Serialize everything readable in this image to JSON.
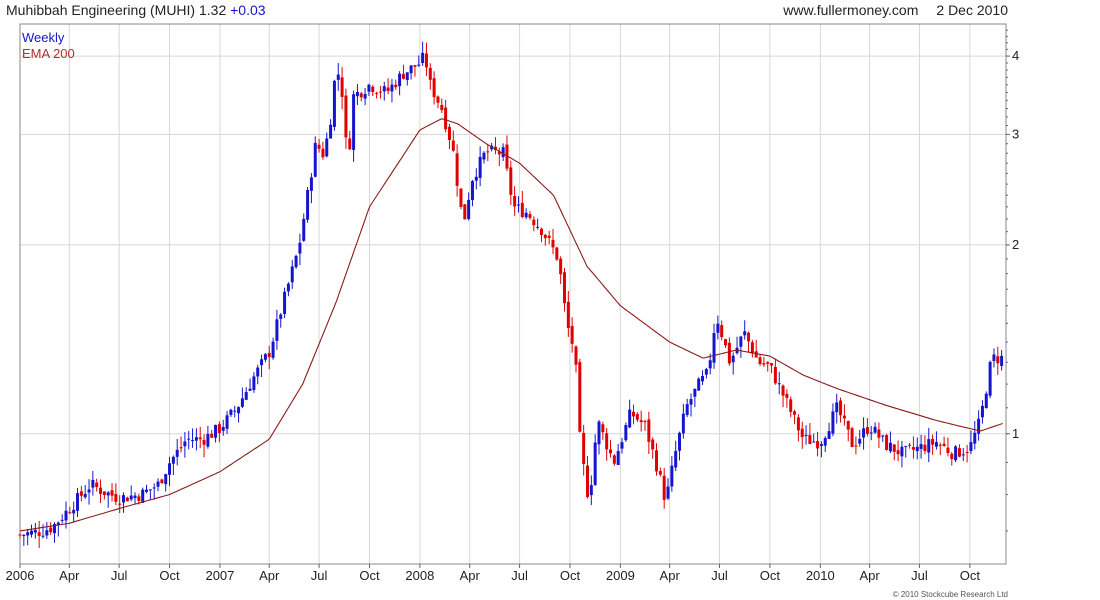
{
  "header": {
    "title": "Muhibbah Engineering (MUHI)",
    "price": "1.32",
    "change": "+0.03",
    "website": "www.fullermoney.com",
    "date": "2 Dec 2010"
  },
  "legend": {
    "series1": "Weekly",
    "series2": "EMA 200"
  },
  "copyright": "© 2010 Stockcube Research Ltd",
  "colors": {
    "up": "#1515d0",
    "down": "#e00000",
    "ema": "#8b1a1a",
    "grid": "#d8d8d8",
    "axis": "#666666"
  },
  "chart_data": {
    "type": "candlestick",
    "title": "Muhibbah Engineering (MUHI) 1.32 +0.03",
    "frequency": "weekly",
    "scale": "log",
    "ylim": [
      0.62,
      4.5
    ],
    "y_ticks": [
      1,
      2,
      3,
      4
    ],
    "x_range": [
      "2006-01-01",
      "2010-12-06"
    ],
    "x_ticks": [
      {
        "label": "2006",
        "date": "2006-01-01"
      },
      {
        "label": "Apr",
        "date": "2006-04-01"
      },
      {
        "label": "Jul",
        "date": "2006-07-01"
      },
      {
        "label": "Oct",
        "date": "2006-10-01"
      },
      {
        "label": "2007",
        "date": "2007-01-01"
      },
      {
        "label": "Apr",
        "date": "2007-04-01"
      },
      {
        "label": "Jul",
        "date": "2007-07-01"
      },
      {
        "label": "Oct",
        "date": "2007-10-01"
      },
      {
        "label": "2008",
        "date": "2008-01-01"
      },
      {
        "label": "Apr",
        "date": "2008-04-01"
      },
      {
        "label": "Jul",
        "date": "2008-07-01"
      },
      {
        "label": "Oct",
        "date": "2008-10-01"
      },
      {
        "label": "2009",
        "date": "2009-01-01"
      },
      {
        "label": "Apr",
        "date": "2009-04-01"
      },
      {
        "label": "Jul",
        "date": "2009-07-01"
      },
      {
        "label": "Oct",
        "date": "2009-10-01"
      },
      {
        "label": "2010",
        "date": "2010-01-01"
      },
      {
        "label": "Apr",
        "date": "2010-04-01"
      },
      {
        "label": "Jul",
        "date": "2010-07-01"
      },
      {
        "label": "Oct",
        "date": "2010-10-01"
      }
    ],
    "price_path": [
      [
        "2006-01-01",
        0.69
      ],
      [
        "2006-02-10",
        0.7
      ],
      [
        "2006-03-01",
        0.71
      ],
      [
        "2006-04-01",
        0.76
      ],
      [
        "2006-05-10",
        0.83
      ],
      [
        "2006-06-01",
        0.81
      ],
      [
        "2006-07-01",
        0.79
      ],
      [
        "2006-08-10",
        0.8
      ],
      [
        "2006-09-10",
        0.83
      ],
      [
        "2006-10-01",
        0.9
      ],
      [
        "2006-11-01",
        0.98
      ],
      [
        "2006-12-01",
        0.98
      ],
      [
        "2007-01-01",
        1.02
      ],
      [
        "2007-02-01",
        1.1
      ],
      [
        "2007-03-01",
        1.22
      ],
      [
        "2007-04-01",
        1.35
      ],
      [
        "2007-04-25",
        1.6
      ],
      [
        "2007-05-25",
        1.98
      ],
      [
        "2007-06-10",
        2.4
      ],
      [
        "2007-06-25",
        2.9
      ],
      [
        "2007-07-10",
        2.78
      ],
      [
        "2007-07-25",
        3.3
      ],
      [
        "2007-08-01",
        3.9
      ],
      [
        "2007-08-15",
        3.4
      ],
      [
        "2007-08-22",
        2.6
      ],
      [
        "2007-09-01",
        3.45
      ],
      [
        "2007-10-01",
        3.6
      ],
      [
        "2007-11-01",
        3.5
      ],
      [
        "2007-12-01",
        3.75
      ],
      [
        "2008-01-01",
        3.9
      ],
      [
        "2008-01-10",
        4.0
      ],
      [
        "2008-01-20",
        3.6
      ],
      [
        "2008-02-10",
        3.3
      ],
      [
        "2008-03-01",
        2.85
      ],
      [
        "2008-03-20",
        2.15
      ],
      [
        "2008-04-05",
        2.55
      ],
      [
        "2008-05-01",
        2.82
      ],
      [
        "2008-06-01",
        2.8
      ],
      [
        "2008-06-20",
        2.3
      ],
      [
        "2008-07-15",
        2.25
      ],
      [
        "2008-08-10",
        2.12
      ],
      [
        "2008-09-10",
        1.9
      ],
      [
        "2008-09-25",
        1.5
      ],
      [
        "2008-10-10",
        1.35
      ],
      [
        "2008-10-20",
        0.95
      ],
      [
        "2008-11-05",
        0.78
      ],
      [
        "2008-11-20",
        1.05
      ],
      [
        "2008-12-20",
        0.9
      ],
      [
        "2009-01-20",
        1.08
      ],
      [
        "2009-02-15",
        1.03
      ],
      [
        "2009-03-10",
        0.88
      ],
      [
        "2009-03-25",
        0.78
      ],
      [
        "2009-04-10",
        0.92
      ],
      [
        "2009-05-01",
        1.1
      ],
      [
        "2009-05-25",
        1.2
      ],
      [
        "2009-06-10",
        1.25
      ],
      [
        "2009-06-25",
        1.55
      ],
      [
        "2009-07-20",
        1.3
      ],
      [
        "2009-08-15",
        1.45
      ],
      [
        "2009-09-10",
        1.3
      ],
      [
        "2009-10-01",
        1.28
      ],
      [
        "2009-11-01",
        1.12
      ],
      [
        "2009-12-01",
        0.98
      ],
      [
        "2010-01-01",
        0.97
      ],
      [
        "2010-02-01",
        1.1
      ],
      [
        "2010-03-01",
        0.96
      ],
      [
        "2010-04-01",
        1.03
      ],
      [
        "2010-05-01",
        0.96
      ],
      [
        "2010-06-01",
        0.93
      ],
      [
        "2010-07-01",
        0.95
      ],
      [
        "2010-08-01",
        0.97
      ],
      [
        "2010-09-01",
        0.93
      ],
      [
        "2010-10-01",
        0.95
      ],
      [
        "2010-10-20",
        1.05
      ],
      [
        "2010-11-10",
        1.32
      ],
      [
        "2010-12-02",
        1.32
      ]
    ],
    "ema_path": [
      [
        "2006-01-01",
        0.7
      ],
      [
        "2006-04-01",
        0.72
      ],
      [
        "2006-07-01",
        0.76
      ],
      [
        "2006-10-01",
        0.8
      ],
      [
        "2007-01-01",
        0.87
      ],
      [
        "2007-04-01",
        0.98
      ],
      [
        "2007-06-01",
        1.2
      ],
      [
        "2007-08-01",
        1.62
      ],
      [
        "2007-10-01",
        2.3
      ],
      [
        "2008-01-01",
        3.05
      ],
      [
        "2008-02-10",
        3.18
      ],
      [
        "2008-03-10",
        3.12
      ],
      [
        "2008-05-01",
        2.9
      ],
      [
        "2008-07-01",
        2.7
      ],
      [
        "2008-09-01",
        2.4
      ],
      [
        "2008-11-01",
        1.85
      ],
      [
        "2009-01-01",
        1.6
      ],
      [
        "2009-04-01",
        1.4
      ],
      [
        "2009-06-01",
        1.32
      ],
      [
        "2009-08-01",
        1.36
      ],
      [
        "2009-10-01",
        1.33
      ],
      [
        "2009-12-01",
        1.24
      ],
      [
        "2010-02-01",
        1.18
      ],
      [
        "2010-05-01",
        1.11
      ],
      [
        "2010-08-01",
        1.05
      ],
      [
        "2010-10-20",
        1.01
      ],
      [
        "2010-12-02",
        1.04
      ]
    ]
  }
}
